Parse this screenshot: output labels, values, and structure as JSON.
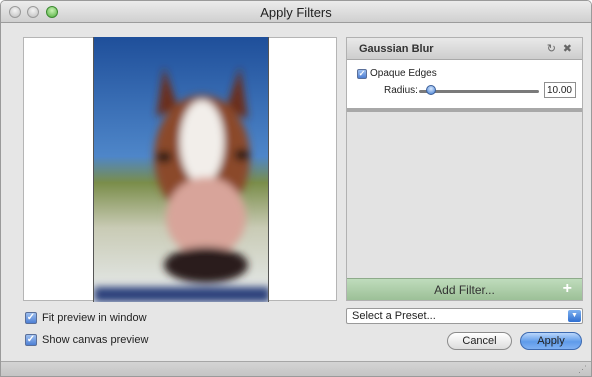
{
  "window": {
    "title": "Apply Filters"
  },
  "filter": {
    "name": "Gaussian Blur",
    "reset_icon": "↻",
    "remove_icon": "✖",
    "opaque_edges_label": "Opaque Edges",
    "radius_label": "Radius:",
    "radius_value": "10.00",
    "radius_level_fraction": 0.1
  },
  "add_filter": {
    "label": "Add Filter...",
    "icon": "+"
  },
  "options": {
    "fit_preview_label": "Fit preview in window",
    "show_canvas_label": "Show canvas preview"
  },
  "preset": {
    "selected": "Select a Preset..."
  },
  "buttons": {
    "cancel": "Cancel",
    "apply": "Apply"
  },
  "colors": {
    "accent": "#4d7fd4",
    "add_filter_bg": "#a8c9a3"
  }
}
